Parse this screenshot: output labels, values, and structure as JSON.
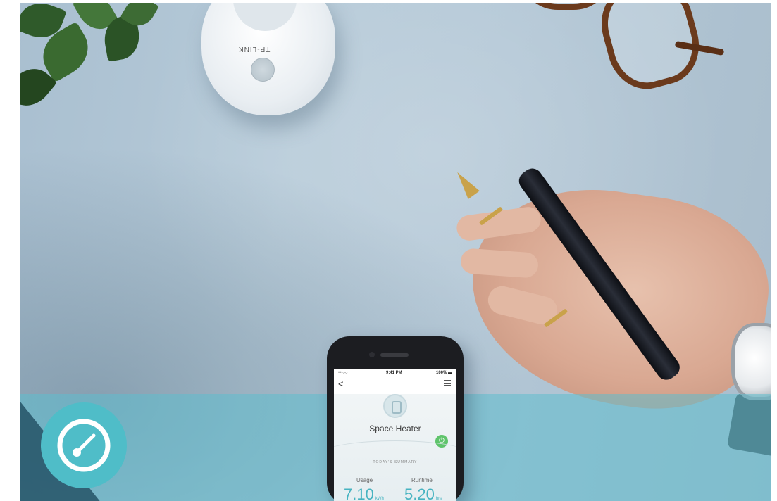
{
  "scene": {
    "description_free": true,
    "plug_brand": "TP-LINK"
  },
  "phone": {
    "statusbar": {
      "carrier": "•••○○ ",
      "time": "9:41 PM",
      "battery": "100% ▬"
    },
    "nav": {
      "back": "<"
    },
    "device_name": "Space Heater",
    "summary_label": "TODAY'S SUMMARY",
    "usage": {
      "label": "Usage",
      "value": "7.10",
      "unit": "kWh"
    },
    "runtime": {
      "label": "Runtime",
      "value": "5.20",
      "unit": "hrs"
    }
  },
  "badge": {
    "icon": "speedometer-icon",
    "color": "#4fbdc8"
  },
  "colors": {
    "accent_teal": "#47b3c1",
    "power_green": "#5fc46b"
  }
}
